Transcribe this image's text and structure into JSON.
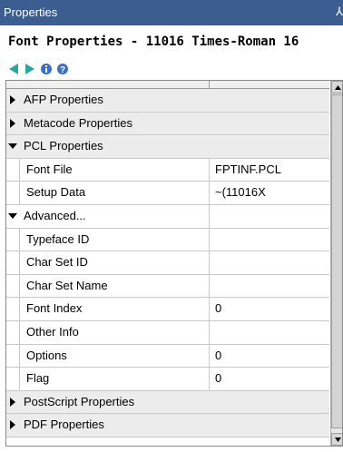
{
  "window": {
    "title": "Properties",
    "pin_glyph": "⅄"
  },
  "header": {
    "text": "Font Properties - 11016  Times-Roman 16"
  },
  "toolbar": {
    "buttons": [
      {
        "icon": "back-arrow-icon",
        "color": "#2aa8a0"
      },
      {
        "icon": "forward-arrow-icon",
        "color": "#2aa8a0"
      },
      {
        "icon": "info-icon",
        "color": "#3a6fc8"
      },
      {
        "icon": "help-icon",
        "color": "#3a6fc8"
      }
    ]
  },
  "grid": {
    "rows": [
      {
        "type": "group",
        "expanded": false,
        "label": "AFP Properties"
      },
      {
        "type": "group",
        "expanded": false,
        "label": "Metacode Properties"
      },
      {
        "type": "group",
        "expanded": true,
        "label": "PCL Properties"
      },
      {
        "type": "prop",
        "label": "Font File",
        "value": "FPTINF.PCL"
      },
      {
        "type": "prop",
        "label": "Setup Data",
        "value": "~(11016X"
      },
      {
        "type": "subgroup",
        "expanded": true,
        "label": "Advanced..."
      },
      {
        "type": "prop",
        "label": "Typeface ID",
        "value": ""
      },
      {
        "type": "prop",
        "label": "Char Set ID",
        "value": ""
      },
      {
        "type": "prop",
        "label": "Char Set Name",
        "value": ""
      },
      {
        "type": "prop",
        "label": "Font Index",
        "value": "0"
      },
      {
        "type": "prop",
        "label": "Other Info",
        "value": ""
      },
      {
        "type": "prop",
        "label": "Options",
        "value": "0"
      },
      {
        "type": "prop",
        "label": "Flag",
        "value": "0"
      },
      {
        "type": "group",
        "expanded": false,
        "label": "PostScript Properties"
      },
      {
        "type": "group",
        "expanded": false,
        "label": "PDF Properties"
      }
    ]
  }
}
